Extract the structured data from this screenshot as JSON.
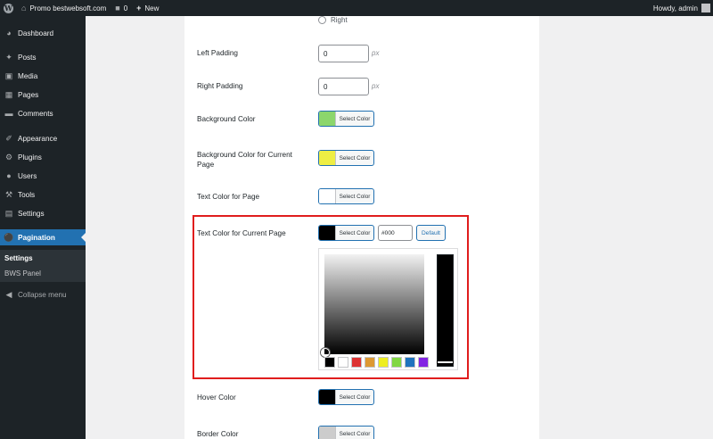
{
  "adminbar": {
    "site_name": "Promo bestwebsoft.com",
    "comments_count": "0",
    "new_label": "New",
    "greeting": "Howdy, admin"
  },
  "sidebar": {
    "items": [
      {
        "label": "Dashboard",
        "icon": "dashboard-icon"
      },
      {
        "label": "Posts",
        "icon": "pin-icon"
      },
      {
        "label": "Media",
        "icon": "media-icon"
      },
      {
        "label": "Pages",
        "icon": "page-icon"
      },
      {
        "label": "Comments",
        "icon": "comment-icon"
      },
      {
        "label": "Appearance",
        "icon": "brush-icon"
      },
      {
        "label": "Plugins",
        "icon": "plug-icon"
      },
      {
        "label": "Users",
        "icon": "user-icon"
      },
      {
        "label": "Tools",
        "icon": "wrench-icon"
      },
      {
        "label": "Settings",
        "icon": "sliders-icon"
      },
      {
        "label": "Pagination",
        "icon": "toggle-icon"
      }
    ],
    "submenu": [
      "Settings",
      "BWS Panel"
    ],
    "collapse_label": "Collapse menu"
  },
  "form": {
    "alignment_option": "Right",
    "left_padding": {
      "label": "Left Padding",
      "value": "0",
      "unit": "px"
    },
    "right_padding": {
      "label": "Right Padding",
      "value": "0",
      "unit": "px"
    },
    "background_color": {
      "label": "Background Color",
      "button": "Select Color",
      "color": "#8cd66c"
    },
    "bg_current": {
      "label": "Background Color for Current Page",
      "button": "Select Color",
      "color": "#eeee44"
    },
    "text_color": {
      "label": "Text Color for Page",
      "button": "Select Color",
      "color": "#ffffff"
    },
    "text_current": {
      "label": "Text Color for Current Page",
      "button": "Select Color",
      "color": "#000000",
      "hex_value": "#000",
      "default_label": "Default"
    },
    "hover_color": {
      "label": "Hover Color",
      "button": "Select Color",
      "color": "#000000"
    },
    "border_color": {
      "label": "Border Color",
      "button": "Select Color",
      "color": "#cccccc"
    }
  },
  "palette": [
    "#000000",
    "#ffffff",
    "#dd3333",
    "#dd9933",
    "#eeee22",
    "#81d742",
    "#1e73be",
    "#8224e3"
  ],
  "colors": {
    "accent": "#2271b1",
    "highlight": "#e01d1d",
    "sidebar_bg": "#1d2327"
  }
}
